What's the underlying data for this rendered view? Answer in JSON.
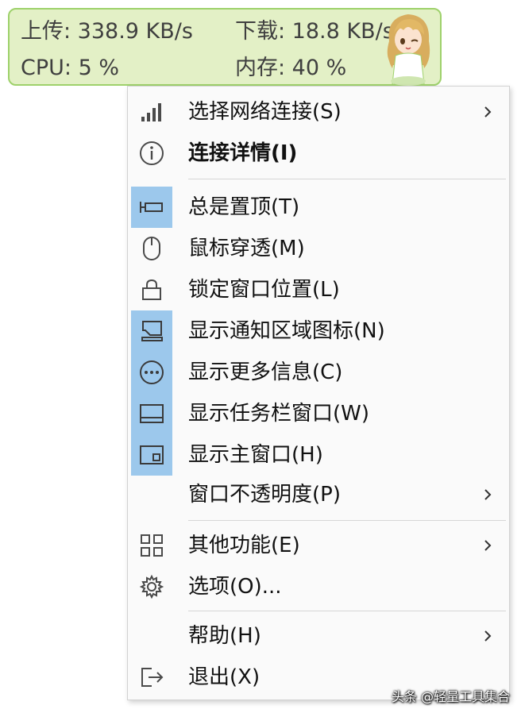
{
  "widget": {
    "upload": "上传: 338.9 KB/s",
    "download": "下载: 18.8 KB/s",
    "cpu": "CPU: 5 %",
    "memory": "内存: 40 %"
  },
  "menu": {
    "items": [
      {
        "label": "选择网络连接(S)",
        "icon": "signal-bars-icon",
        "submenu": true,
        "checked": false
      },
      {
        "label": "连接详情(I)",
        "icon": "info-icon",
        "bold": true,
        "checked": false
      },
      {
        "label": "总是置顶(T)",
        "icon": "pin-icon",
        "checked": true
      },
      {
        "label": "鼠标穿透(M)",
        "icon": "mouse-icon",
        "checked": false
      },
      {
        "label": "锁定窗口位置(L)",
        "icon": "lock-icon",
        "checked": false
      },
      {
        "label": "显示通知区域图标(N)",
        "icon": "notification-area-icon",
        "checked": true
      },
      {
        "label": "显示更多信息(C)",
        "icon": "more-info-icon",
        "checked": true
      },
      {
        "label": "显示任务栏窗口(W)",
        "icon": "taskbar-window-icon",
        "checked": true
      },
      {
        "label": "显示主窗口(H)",
        "icon": "main-window-icon",
        "checked": true
      },
      {
        "label": "窗口不透明度(P)",
        "icon": "",
        "submenu": true,
        "checked": false
      },
      {
        "label": "其他功能(E)",
        "icon": "grid-icon",
        "submenu": true,
        "checked": false
      },
      {
        "label": "选项(O)...",
        "icon": "gear-icon",
        "checked": false
      },
      {
        "label": "帮助(H)",
        "icon": "",
        "submenu": true,
        "checked": false
      },
      {
        "label": "退出(X)",
        "icon": "exit-icon",
        "checked": false
      }
    ]
  },
  "watermark": "头条 @轻量工具集合",
  "colors": {
    "widget_bg": "#e3f0c6",
    "widget_border": "#9ed16b",
    "checked_bg": "#9cc8ec",
    "menu_bg": "#fafafa"
  }
}
